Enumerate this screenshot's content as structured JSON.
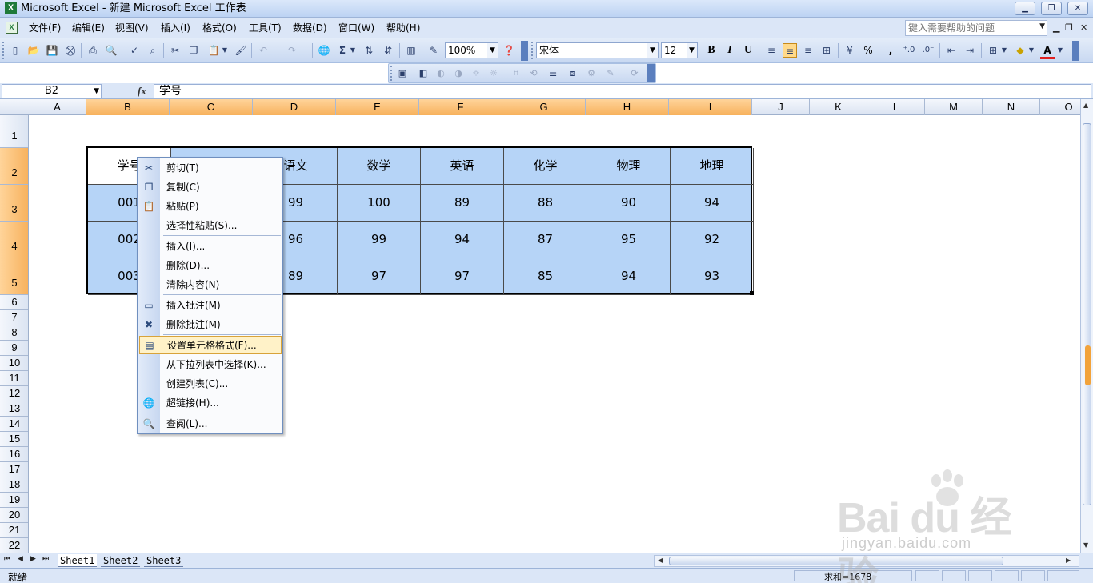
{
  "window": {
    "title": "Microsoft Excel - 新建 Microsoft Excel 工作表",
    "app_icon": "X"
  },
  "menubar": {
    "items": [
      "文件(F)",
      "编辑(E)",
      "视图(V)",
      "插入(I)",
      "格式(O)",
      "工具(T)",
      "数据(D)",
      "窗口(W)",
      "帮助(H)"
    ],
    "help_placeholder": "键入需要帮助的问题"
  },
  "toolbar": {
    "zoom": "100%",
    "font_name": "宋体",
    "font_size": "12",
    "bold": "B",
    "italic": "I",
    "underline": "U",
    "percent": "%",
    "comma": ","
  },
  "formula_bar": {
    "name_box": "B2",
    "fx": "fx",
    "value": "学号"
  },
  "columns": [
    "A",
    "B",
    "C",
    "D",
    "E",
    "F",
    "G",
    "H",
    "I",
    "J",
    "K",
    "L",
    "M",
    "N",
    "O"
  ],
  "selected_columns": [
    "B",
    "C",
    "D",
    "E",
    "F",
    "G",
    "H",
    "I"
  ],
  "rows": [
    "1",
    "2",
    "3",
    "4",
    "5",
    "6",
    "7",
    "8",
    "9",
    "10",
    "11",
    "12",
    "13",
    "14",
    "15",
    "16",
    "17",
    "18",
    "19",
    "20",
    "21",
    "22"
  ],
  "selected_rows": [
    "2",
    "3",
    "4",
    "5"
  ],
  "table": {
    "header": [
      "学号",
      "",
      "语文",
      "数学",
      "英语",
      "化学",
      "物理",
      "地理"
    ],
    "rows": [
      [
        "001",
        "",
        "99",
        "100",
        "89",
        "88",
        "90",
        "94"
      ],
      [
        "002",
        "",
        "96",
        "99",
        "94",
        "87",
        "95",
        "92"
      ],
      [
        "003",
        "",
        "89",
        "97",
        "97",
        "85",
        "94",
        "93"
      ]
    ]
  },
  "context_menu": {
    "items": [
      {
        "label": "剪切(T)",
        "icon": "scissors-icon",
        "glyph": "✂"
      },
      {
        "label": "复制(C)",
        "icon": "copy-icon",
        "glyph": "❐"
      },
      {
        "label": "粘贴(P)",
        "icon": "paste-icon",
        "glyph": "📋"
      },
      {
        "label": "选择性粘贴(S)...",
        "icon": "",
        "glyph": ""
      },
      {
        "label": "插入(I)...",
        "icon": "",
        "glyph": ""
      },
      {
        "label": "删除(D)...",
        "icon": "",
        "glyph": ""
      },
      {
        "label": "清除内容(N)",
        "icon": "",
        "glyph": ""
      },
      {
        "label": "插入批注(M)",
        "icon": "insert-comment-icon",
        "glyph": "▭"
      },
      {
        "label": "删除批注(M)",
        "icon": "delete-comment-icon",
        "glyph": "✖"
      },
      {
        "label": "设置单元格格式(F)...",
        "icon": "format-cells-icon",
        "glyph": "▤"
      },
      {
        "label": "从下拉列表中选择(K)...",
        "icon": "",
        "glyph": ""
      },
      {
        "label": "创建列表(C)...",
        "icon": "",
        "glyph": ""
      },
      {
        "label": "超链接(H)...",
        "icon": "hyperlink-icon",
        "glyph": "🌐"
      },
      {
        "label": "查阅(L)...",
        "icon": "research-icon",
        "glyph": "🔍"
      }
    ],
    "highlighted_index": 9
  },
  "sheet_tabs": [
    "Sheet1",
    "Sheet2",
    "Sheet3"
  ],
  "active_sheet": "Sheet1",
  "status": {
    "ready": "就绪",
    "sum": "求和=1678"
  },
  "watermark": {
    "main": "Bai du 经验",
    "sub": "jingyan.baidu.com"
  },
  "colors": {
    "selection_fill": "#b6d4f7",
    "header_selected": "#f7b15c",
    "menu_hot": "#fff2c8"
  }
}
